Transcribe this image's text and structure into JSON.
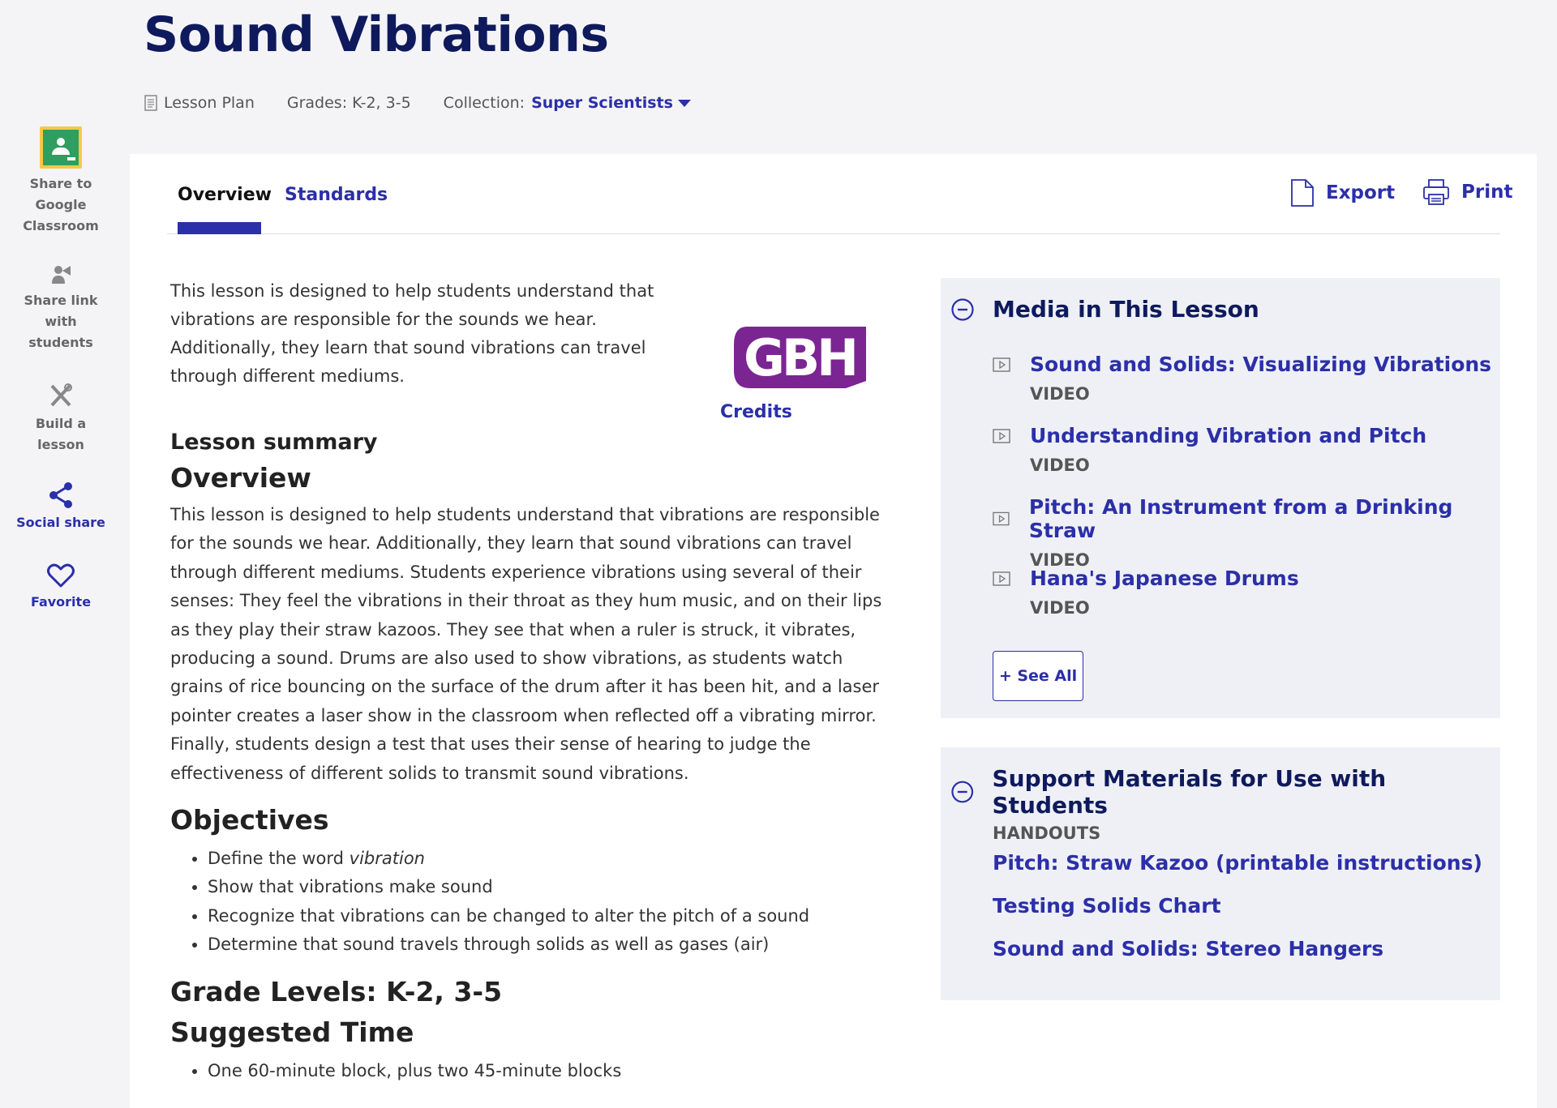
{
  "header": {
    "title": "Sound Vibrations",
    "type_label": "Lesson Plan",
    "grades": "Grades: K-2, 3-5",
    "collection_label": "Collection:",
    "collection_name": "Super Scientists"
  },
  "rail": {
    "classroom_line1": "Share to",
    "classroom_line2": "Google",
    "classroom_line3": "Classroom",
    "sharelink_line1": "Share link",
    "sharelink_line2": "with",
    "sharelink_line3": "students",
    "build_line1": "Build a",
    "build_line2": "lesson",
    "social": "Social share",
    "favorite": "Favorite"
  },
  "tabs": {
    "overview": "Overview",
    "standards": "Standards"
  },
  "tools": {
    "export": "Export",
    "print": "Print"
  },
  "intro": {
    "line1": "This lesson is designed to help students understand that",
    "line2": "vibrations are responsible for the sounds we hear.",
    "line3": "Additionally, they learn that sound vibrations can travel",
    "line4": "through different mediums."
  },
  "logo": {
    "text": "GBH",
    "credits": "Credits",
    "color": "#7b2592"
  },
  "summary": {
    "title": "Lesson summary",
    "overview_heading": "Overview",
    "lines": [
      "This lesson is designed to help students understand that vibrations are responsible",
      "for the sounds we hear. Additionally, they learn that sound vibrations can travel",
      "through different mediums. Students experience vibrations using several of their",
      "senses: They feel the vibrations in their throat as they hum music, and on their lips",
      "as they play their straw kazoos. They see that when a ruler is struck, it vibrates,",
      "producing a sound. Drums are also used to show vibrations, as students watch",
      "grains of rice bouncing on the surface of the drum after it has been hit, and a laser",
      "pointer creates a laser show in the classroom when reflected off a vibrating mirror.",
      "Finally, students design a test that uses their sense of hearing to judge the",
      "effectiveness of different solids to transmit sound vibrations."
    ]
  },
  "objectives": {
    "heading": "Objectives",
    "item1_prefix": "Define the word ",
    "item1_em": "vibration",
    "item2": "Show that vibrations make sound",
    "item3": "Recognize that vibrations can be changed to alter the pitch of a sound",
    "item4": "Determine that sound travels through solids as well as gases (air)"
  },
  "grade_levels": "Grade Levels: K-2, 3-5",
  "suggested_time": {
    "heading": "Suggested Time",
    "item1": "One 60-minute block, plus two 45-minute blocks"
  },
  "media": {
    "heading": "Media in This Lesson",
    "items": [
      {
        "title": "Sound and Solids: Visualizing Vibrations",
        "type": "VIDEO"
      },
      {
        "title": "Understanding Vibration and Pitch",
        "type": "VIDEO"
      },
      {
        "title": "Pitch: An Instrument from a Drinking Straw",
        "type": "VIDEO"
      },
      {
        "title": "Hana's Japanese Drums",
        "type": "VIDEO"
      }
    ],
    "see_all": "+ See All"
  },
  "support": {
    "heading": "Support Materials for Use with Students",
    "handouts_label": "HANDOUTS",
    "links": [
      "Pitch: Straw Kazoo (printable instructions)",
      "Testing Solids Chart",
      "Sound and Solids: Stereo Hangers"
    ]
  },
  "colors": {
    "accent": "#2b2fa8",
    "title": "#0e1a5c",
    "background": "#f4f4f7",
    "card": "#eff0f5"
  }
}
